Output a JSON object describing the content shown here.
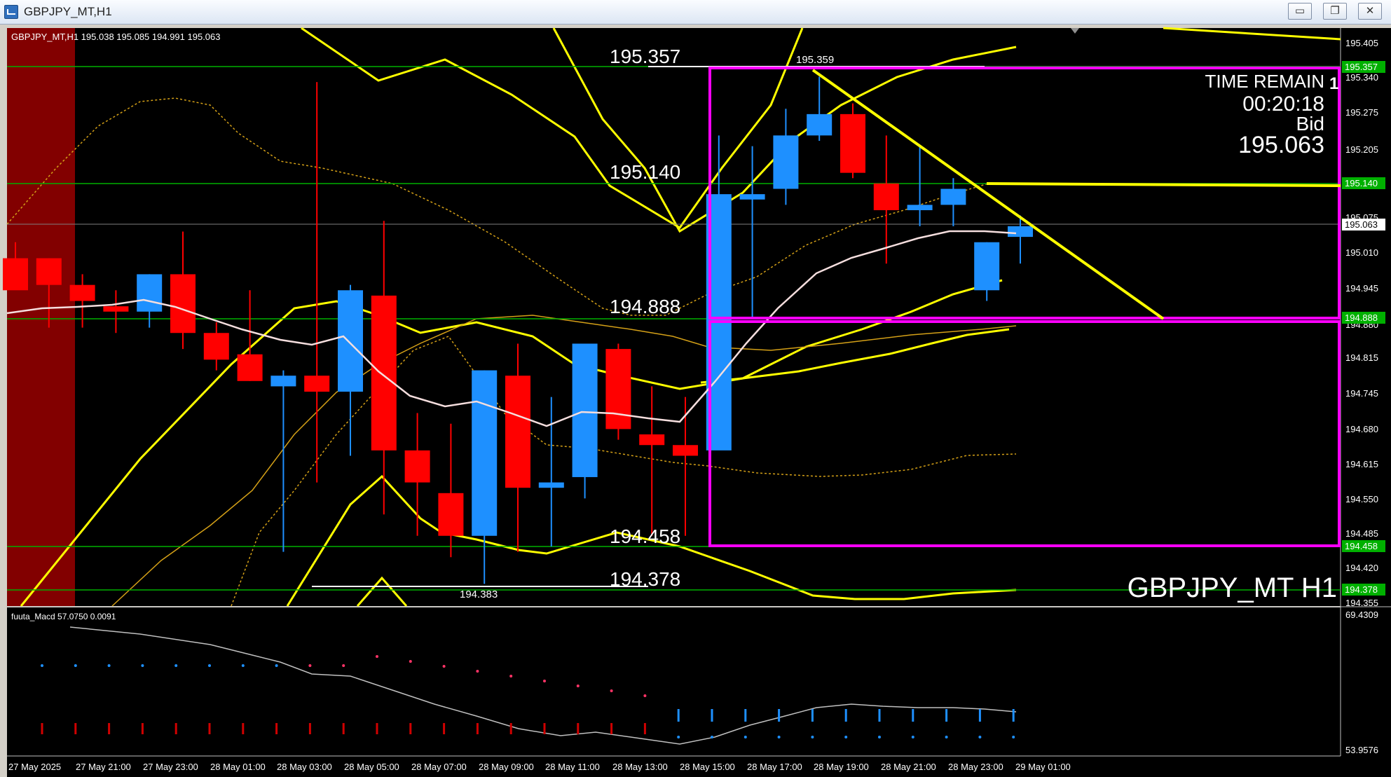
{
  "window": {
    "title": "GBPJPY_MT,H1",
    "minimize_glyph": "▭",
    "restore_glyph": "❐",
    "close_glyph": "✕"
  },
  "chart_info": {
    "header": "GBPJPY_MT,H1  195.038 195.085 194.991 195.063",
    "watermark": "GBPJPY_MT H1",
    "time_remain_label": "TIME REMAIN",
    "time_remain_value": "00:20:18",
    "bid_label": "Bid",
    "bid_value": "195.063",
    "corner_marker": "1"
  },
  "price_axis": {
    "labels": [
      "195.405",
      "195.340",
      "195.275",
      "195.205",
      "195.075",
      "195.010",
      "194.945",
      "194.880",
      "194.815",
      "194.745",
      "194.680",
      "194.615",
      "194.550",
      "194.485",
      "194.420",
      "194.355"
    ],
    "tags": {
      "p195357": "195.357",
      "p195140": "195.140",
      "p195063": "195.063",
      "p194888": "194.888",
      "p194458": "194.458",
      "p194378": "194.378"
    }
  },
  "levels": {
    "l195357": "195.357",
    "l195140": "195.140",
    "l194888": "194.888",
    "l194458": "194.458",
    "l194378": "194.378",
    "high_mark": "195.359",
    "low_mark": "194.383"
  },
  "time_axis": [
    "27 May 2025",
    "27 May 21:00",
    "27 May 23:00",
    "28 May 01:00",
    "28 May 03:00",
    "28 May 05:00",
    "28 May 07:00",
    "28 May 09:00",
    "28 May 11:00",
    "28 May 13:00",
    "28 May 15:00",
    "28 May 17:00",
    "28 May 19:00",
    "28 May 21:00",
    "28 May 23:00",
    "29 May 01:00"
  ],
  "indicator": {
    "header": "fuuta_Macd 57.0750  0.0091",
    "axis_top": "69.4309",
    "axis_bottom": "53.9576"
  },
  "colors": {
    "background": "#000000",
    "bull": "#1e90ff",
    "bear": "#ff0000",
    "level_line": "#00c000",
    "band": "#ffff00",
    "box": "#ff00ff",
    "ma": "#f5dede"
  },
  "chart_data": {
    "type": "candlestick",
    "price_range": [
      194.355,
      195.405
    ],
    "candles": [
      {
        "o": 195.0,
        "h": 195.03,
        "l": 194.96,
        "c": 194.94
      },
      {
        "o": 195.0,
        "h": 195.0,
        "l": 194.87,
        "c": 194.95
      },
      {
        "o": 194.95,
        "h": 194.97,
        "l": 194.87,
        "c": 194.92
      },
      {
        "o": 194.91,
        "h": 194.94,
        "l": 194.86,
        "c": 194.9
      },
      {
        "o": 194.9,
        "h": 194.97,
        "l": 194.87,
        "c": 194.97
      },
      {
        "o": 194.97,
        "h": 195.05,
        "l": 194.83,
        "c": 194.86
      },
      {
        "o": 194.86,
        "h": 194.88,
        "l": 194.79,
        "c": 194.81
      },
      {
        "o": 194.82,
        "h": 194.94,
        "l": 194.77,
        "c": 194.77
      },
      {
        "o": 194.76,
        "h": 194.79,
        "l": 194.45,
        "c": 194.78
      },
      {
        "o": 194.78,
        "h": 195.33,
        "l": 194.58,
        "c": 194.75
      },
      {
        "o": 194.75,
        "h": 194.95,
        "l": 194.63,
        "c": 194.94
      },
      {
        "o": 194.93,
        "h": 195.07,
        "l": 194.52,
        "c": 194.64
      },
      {
        "o": 194.64,
        "h": 194.71,
        "l": 194.48,
        "c": 194.58
      },
      {
        "o": 194.56,
        "h": 194.69,
        "l": 194.44,
        "c": 194.48
      },
      {
        "o": 194.48,
        "h": 194.79,
        "l": 194.39,
        "c": 194.79
      },
      {
        "o": 194.78,
        "h": 194.84,
        "l": 194.45,
        "c": 194.57
      },
      {
        "o": 194.57,
        "h": 194.74,
        "l": 194.46,
        "c": 194.58
      },
      {
        "o": 194.59,
        "h": 194.84,
        "l": 194.55,
        "c": 194.84
      },
      {
        "o": 194.83,
        "h": 194.84,
        "l": 194.66,
        "c": 194.68
      },
      {
        "o": 194.67,
        "h": 194.76,
        "l": 194.48,
        "c": 194.65
      },
      {
        "o": 194.65,
        "h": 194.74,
        "l": 194.48,
        "c": 194.63
      },
      {
        "o": 194.64,
        "h": 195.23,
        "l": 194.66,
        "c": 195.12
      },
      {
        "o": 195.11,
        "h": 195.21,
        "l": 194.89,
        "c": 195.12
      },
      {
        "o": 195.13,
        "h": 195.28,
        "l": 195.1,
        "c": 195.23
      },
      {
        "o": 195.23,
        "h": 195.34,
        "l": 195.22,
        "c": 195.27
      },
      {
        "o": 195.27,
        "h": 195.29,
        "l": 195.15,
        "c": 195.16
      },
      {
        "o": 195.14,
        "h": 195.23,
        "l": 194.99,
        "c": 195.09
      },
      {
        "o": 195.09,
        "h": 195.21,
        "l": 195.06,
        "c": 195.1
      },
      {
        "o": 195.1,
        "h": 195.15,
        "l": 195.06,
        "c": 195.13
      },
      {
        "o": 194.94,
        "h": 195.03,
        "l": 194.92,
        "c": 195.03
      },
      {
        "o": 195.04,
        "h": 195.08,
        "l": 194.99,
        "c": 195.06
      }
    ]
  }
}
